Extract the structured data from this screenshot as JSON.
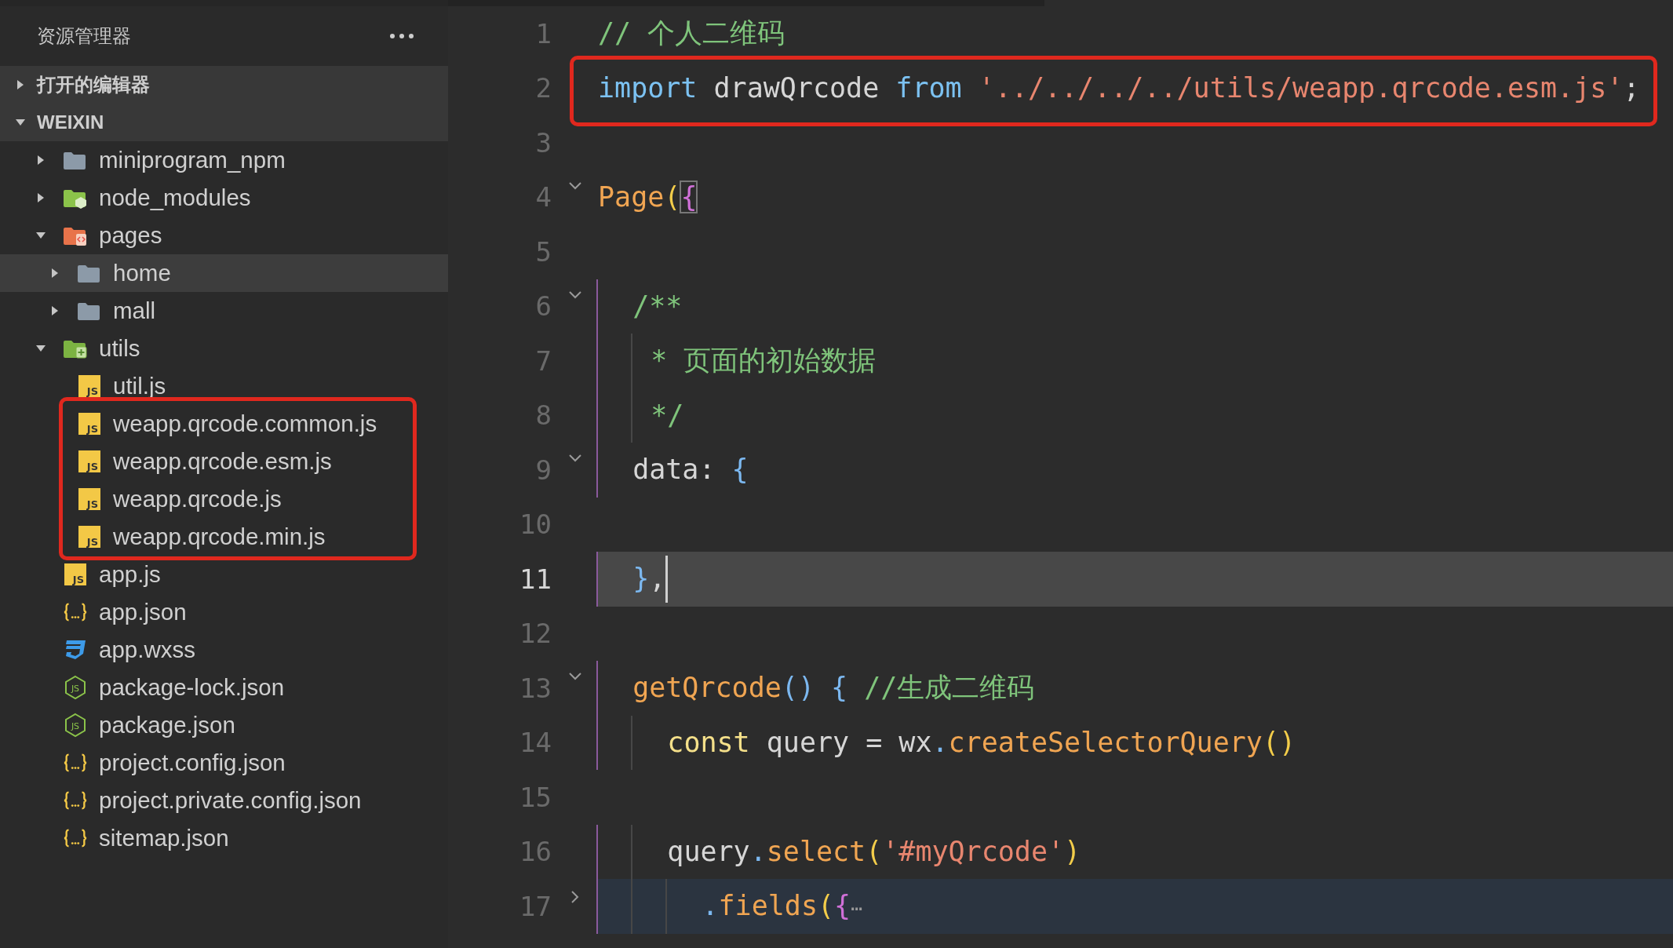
{
  "sidebar": {
    "title": "资源管理器",
    "sections": [
      {
        "label": "打开的编辑器",
        "expanded": false
      },
      {
        "label": "WEIXIN",
        "expanded": true,
        "items": [
          {
            "name": "miniprogram_npm",
            "kind": "folder",
            "expanded": false,
            "selected": false,
            "annotated": false
          },
          {
            "name": "node_modules",
            "kind": "node-folder",
            "expanded": false,
            "selected": false,
            "annotated": false
          },
          {
            "name": "pages",
            "kind": "pages-folder",
            "expanded": true,
            "selected": false,
            "annotated": false,
            "children": [
              {
                "name": "home",
                "kind": "folder",
                "expanded": false,
                "selected": true,
                "annotated": false
              },
              {
                "name": "mall",
                "kind": "folder",
                "expanded": false,
                "selected": false,
                "annotated": false
              }
            ]
          },
          {
            "name": "utils",
            "kind": "utils-folder",
            "expanded": true,
            "selected": false,
            "annotated": false,
            "children": [
              {
                "name": "util.js",
                "kind": "js",
                "icon_text": "JS",
                "selected": false,
                "annotated": false
              },
              {
                "name": "weapp.qrcode.common.js",
                "kind": "js",
                "icon_text": "JS",
                "selected": false,
                "annotated": true
              },
              {
                "name": "weapp.qrcode.esm.js",
                "kind": "js",
                "icon_text": "JS",
                "selected": false,
                "annotated": true
              },
              {
                "name": "weapp.qrcode.js",
                "kind": "js",
                "icon_text": "JS",
                "selected": false,
                "annotated": true
              },
              {
                "name": "weapp.qrcode.min.js",
                "kind": "js",
                "icon_text": "JS",
                "selected": false,
                "annotated": true
              }
            ]
          },
          {
            "name": "app.js",
            "kind": "js",
            "icon_text": "JS",
            "selected": false,
            "annotated": false
          },
          {
            "name": "app.json",
            "kind": "json",
            "selected": false,
            "annotated": false
          },
          {
            "name": "app.wxss",
            "kind": "css",
            "selected": false,
            "annotated": false
          },
          {
            "name": "package-lock.json",
            "kind": "npm",
            "icon_text": "JS",
            "selected": false,
            "annotated": false
          },
          {
            "name": "package.json",
            "kind": "npm",
            "icon_text": "JS",
            "selected": false,
            "annotated": false
          },
          {
            "name": "project.config.json",
            "kind": "json",
            "selected": false,
            "annotated": false
          },
          {
            "name": "project.private.config.json",
            "kind": "json",
            "selected": false,
            "annotated": false
          },
          {
            "name": "sitemap.json",
            "kind": "json",
            "selected": false,
            "annotated": false
          }
        ]
      }
    ]
  },
  "editor": {
    "lines": [
      {
        "number": "1",
        "current": false,
        "annotated": false,
        "tokens": [
          {
            "text": "// 个人二维码",
            "kind": "comment"
          }
        ]
      },
      {
        "number": "2",
        "current": false,
        "annotated": true,
        "tokens": [
          {
            "text": "import",
            "kind": "keyword"
          },
          {
            "text": " drawQrcode ",
            "kind": "plain"
          },
          {
            "text": "from",
            "kind": "keyword"
          },
          {
            "text": " '../../../../utils/weapp.qrcode.esm.js'",
            "kind": "string"
          },
          {
            "text": ";",
            "kind": "plain"
          }
        ]
      },
      {
        "number": "3",
        "current": false,
        "annotated": false
      },
      {
        "number": "4",
        "expanded": true,
        "current": false,
        "annotated": false,
        "tokens": [
          {
            "text": "Page",
            "kind": "func"
          },
          {
            "text": "(",
            "kind": "bracket-yellow"
          },
          {
            "text": "{",
            "kind": "bracket-purple",
            "matched": true
          }
        ]
      },
      {
        "number": "5",
        "current": false,
        "annotated": false
      },
      {
        "number": "6",
        "expanded": true,
        "current": false,
        "annotated": false,
        "tokens": [
          {
            "text": "  /**",
            "kind": "comment"
          }
        ]
      },
      {
        "number": "7",
        "current": false,
        "annotated": false,
        "tokens": [
          {
            "text": "   * 页面的初始数据",
            "kind": "comment"
          }
        ]
      },
      {
        "number": "8",
        "current": false,
        "annotated": false,
        "tokens": [
          {
            "text": "   */",
            "kind": "comment"
          }
        ]
      },
      {
        "number": "9",
        "expanded": true,
        "current": false,
        "annotated": false,
        "tokens": [
          {
            "text": "  data: ",
            "kind": "plain"
          },
          {
            "text": "{",
            "kind": "bracket-blue"
          }
        ]
      },
      {
        "number": "10",
        "current": false,
        "annotated": false
      },
      {
        "number": "11",
        "current": true,
        "annotated": false,
        "tokens": [
          {
            "text": "  }",
            "kind": "bracket-blue"
          },
          {
            "text": ",",
            "kind": "plain"
          }
        ]
      },
      {
        "number": "12",
        "current": false,
        "annotated": false
      },
      {
        "number": "13",
        "expanded": true,
        "current": false,
        "annotated": false,
        "tokens": [
          {
            "text": "  getQrcode",
            "kind": "func"
          },
          {
            "text": "() {",
            "kind": "bracket-blue"
          },
          {
            "text": " //生成二维码",
            "kind": "comment"
          }
        ]
      },
      {
        "number": "14",
        "current": false,
        "annotated": false,
        "tokens": [
          {
            "text": "    const",
            "kind": "storage"
          },
          {
            "text": " query = wx",
            "kind": "plain"
          },
          {
            "text": ".",
            "kind": "punct"
          },
          {
            "text": "createSelectorQuery",
            "kind": "func"
          },
          {
            "text": "()",
            "kind": "bracket-yellow"
          }
        ]
      },
      {
        "number": "15",
        "current": false,
        "annotated": false
      },
      {
        "number": "16",
        "current": false,
        "annotated": false,
        "tokens": [
          {
            "text": "    query",
            "kind": "plain"
          },
          {
            "text": ".",
            "kind": "punct"
          },
          {
            "text": "select",
            "kind": "func"
          },
          {
            "text": "(",
            "kind": "bracket-yellow"
          },
          {
            "text": "'#myQrcode'",
            "kind": "string"
          },
          {
            "text": ")",
            "kind": "bracket-yellow"
          }
        ]
      },
      {
        "number": "17",
        "expanded": false,
        "current": false,
        "annotated": false,
        "tokens": [
          {
            "text": "      .",
            "kind": "punct"
          },
          {
            "text": "fields",
            "kind": "func"
          },
          {
            "text": "(",
            "kind": "bracket-yellow"
          },
          {
            "text": "{",
            "kind": "bracket-purple"
          },
          {
            "text": "⋯",
            "kind": "ellipsis"
          }
        ]
      }
    ]
  }
}
